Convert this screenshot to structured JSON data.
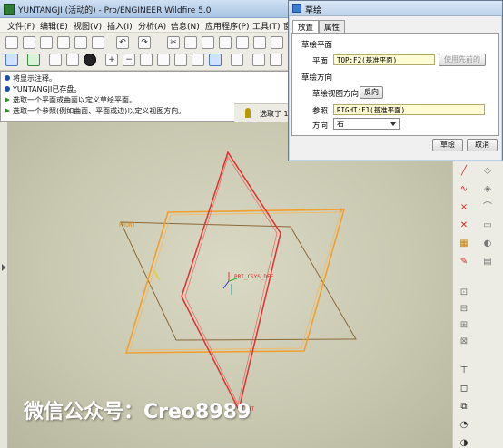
{
  "window": {
    "title": "YUNTANGJI (活动的) - Pro/ENGINEER Wildfire 5.0"
  },
  "menu": [
    "文件(F)",
    "编辑(E)",
    "视图(V)",
    "插入(I)",
    "分析(A)",
    "信息(N)",
    "应用程序(P)",
    "工具(T)",
    "窗"
  ],
  "messages": [
    {
      "type": "info",
      "text": "将显示注释。"
    },
    {
      "type": "info",
      "text": "YUNTANGJI已存盘。"
    },
    {
      "type": "prompt",
      "text": "选取一个平面或曲面以定义草绘平面。"
    },
    {
      "type": "prompt",
      "text": "选取一个参照(例如曲面、平面或边)以定义视图方向。"
    }
  ],
  "status": {
    "filter_text": "选取了 1"
  },
  "dialog": {
    "title": "草绘",
    "tabs": [
      "放置",
      "属性"
    ],
    "sketch_plane_section": "草绘平面",
    "plane_label": "平面",
    "plane_value": "TOP:F2(基准平面)",
    "use_previous_button": "使用先前的",
    "orientation_section": "草绘方向",
    "view_direction_label": "草绘视图方向",
    "flip_button": "反向",
    "reference_label": "参照",
    "reference_value": "RIGHT:F1(基准平面)",
    "direction_label": "方向",
    "direction_value": "右",
    "sketch_button": "草绘",
    "cancel_button": "取消"
  },
  "graphics": {
    "labels": {
      "top_plane": "FRONT",
      "csys": "PRT_CSYS_DEF",
      "right_plane": "RIGHT"
    },
    "colors": {
      "background": "#c8c7b0",
      "top_plane": "#f0a030",
      "front_plane": "#8a6a3a",
      "right_plane": "#e03030"
    }
  },
  "watermark": "微信公众号：Creo8989"
}
